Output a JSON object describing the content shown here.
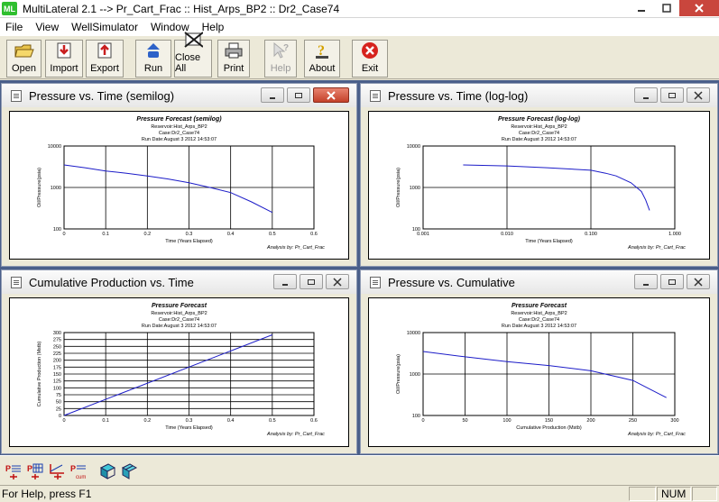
{
  "window": {
    "app_icon": "ML",
    "title": "MultiLateral 2.1 --> Pr_Cart_Frac  ::  Hist_Arps_BP2  ::  Dr2_Case74",
    "controls": [
      "minimize",
      "maximize",
      "close"
    ]
  },
  "menu": [
    "File",
    "View",
    "WellSimulator",
    "Window",
    "Help"
  ],
  "toolbar": {
    "open": "Open",
    "import": "Import",
    "export": "Export",
    "run": "Run",
    "close_all": "Close All",
    "print": "Print",
    "help": "Help",
    "about": "About",
    "exit": "Exit"
  },
  "windows": {
    "w1": {
      "title": "Pressure vs. Time (semilog)"
    },
    "w2": {
      "title": "Pressure vs. Time (log-log)"
    },
    "w3": {
      "title": "Cumulative Production vs. Time"
    },
    "w4": {
      "title": "Pressure vs. Cumulative"
    }
  },
  "chart_data": [
    {
      "type": "line",
      "title": "Pressure Forecast (semilog)",
      "subtitle": [
        "Reservoir:Hist_Arps_BP2",
        "Case:Dr2_Case74",
        "Run Date:August 3 2012 14:53:07"
      ],
      "xlabel": "Time (Years Elapsed)",
      "ylabel": "Oil/Pressure(psia)",
      "yscale": "log",
      "xlim": [
        0,
        0.6
      ],
      "ylim": [
        100,
        10000
      ],
      "xticks": [
        "0",
        "0.1",
        "0.2",
        "0.3",
        "0.4",
        "0.5",
        "0.6"
      ],
      "yticks": [
        "10000",
        "1000",
        "100"
      ],
      "footer": "Analysis by: Pr_Cart_Frac",
      "series": [
        {
          "x": [
            0,
            0.05,
            0.1,
            0.15,
            0.2,
            0.25,
            0.3,
            0.35,
            0.4,
            0.45,
            0.5
          ],
          "y": [
            3500,
            3000,
            2500,
            2200,
            1900,
            1600,
            1300,
            1000,
            750,
            450,
            250
          ]
        }
      ]
    },
    {
      "type": "line",
      "title": "Pressure Forecast (log-log)",
      "subtitle": [
        "Reservoir:Hist_Arps_BP2",
        "Case:Dr2_Case74",
        "Run Date:August 3 2012 14:53:07"
      ],
      "xlabel": "Time (Years Elapsed)",
      "ylabel": "Oil/Pressure(psia)",
      "xscale": "log",
      "yscale": "log",
      "xlim": [
        0.001,
        1
      ],
      "ylim": [
        100,
        10000
      ],
      "xticks": [
        "0.001",
        "0.010",
        "0.100",
        "1.000"
      ],
      "yticks": [
        "10000",
        "1000",
        "100"
      ],
      "footer": "Analysis by: Pr_Cart_Frac",
      "series": [
        {
          "x": [
            0.003,
            0.01,
            0.03,
            0.1,
            0.15,
            0.2,
            0.3,
            0.4,
            0.45,
            0.5
          ],
          "y": [
            3500,
            3300,
            3000,
            2600,
            2200,
            1900,
            1300,
            800,
            500,
            280
          ]
        }
      ]
    },
    {
      "type": "line",
      "title": "Pressure Forecast",
      "subtitle": [
        "Reservoir:Hist_Arps_BP2",
        "Case:Dr2_Case74",
        "Run Date:August 3 2012 14:53:07"
      ],
      "xlabel": "Time (Years Elapsed)",
      "ylabel": "Cumulative Production (Mstb)",
      "xlim": [
        0,
        0.6
      ],
      "ylim": [
        0,
        300
      ],
      "xticks": [
        "0",
        "0.1",
        "0.2",
        "0.3",
        "0.4",
        "0.5",
        "0.6"
      ],
      "yticks": [
        "300",
        "275",
        "250",
        "225",
        "200",
        "175",
        "150",
        "125",
        "100",
        "75",
        "50",
        "25",
        "0"
      ],
      "footer": "Analysis by: Pr_Cart_Frac",
      "series": [
        {
          "x": [
            0,
            0.5
          ],
          "y": [
            0,
            292
          ]
        }
      ]
    },
    {
      "type": "line",
      "title": "Pressure Forecast",
      "subtitle": [
        "Reservoir:Hist_Arps_BP2",
        "Case:Dr2_Case74",
        "Run Date:August 3 2012 14:53:07"
      ],
      "xlabel": "Cumulative Production (Mstb)",
      "ylabel": "Oil/Pressure(psia)",
      "yscale": "log",
      "xlim": [
        0,
        300
      ],
      "ylim": [
        100,
        10000
      ],
      "xticks": [
        "0",
        "50",
        "100",
        "150",
        "200",
        "250",
        "300"
      ],
      "yticks": [
        "10000",
        "1000",
        "100"
      ],
      "footer": "Analysis by: Pr_Cart_Frac",
      "series": [
        {
          "x": [
            0,
            50,
            100,
            150,
            200,
            250,
            290
          ],
          "y": [
            3500,
            2600,
            2000,
            1600,
            1200,
            700,
            270
          ]
        }
      ]
    }
  ],
  "status": {
    "help": "For Help, press F1",
    "num": "NUM"
  }
}
